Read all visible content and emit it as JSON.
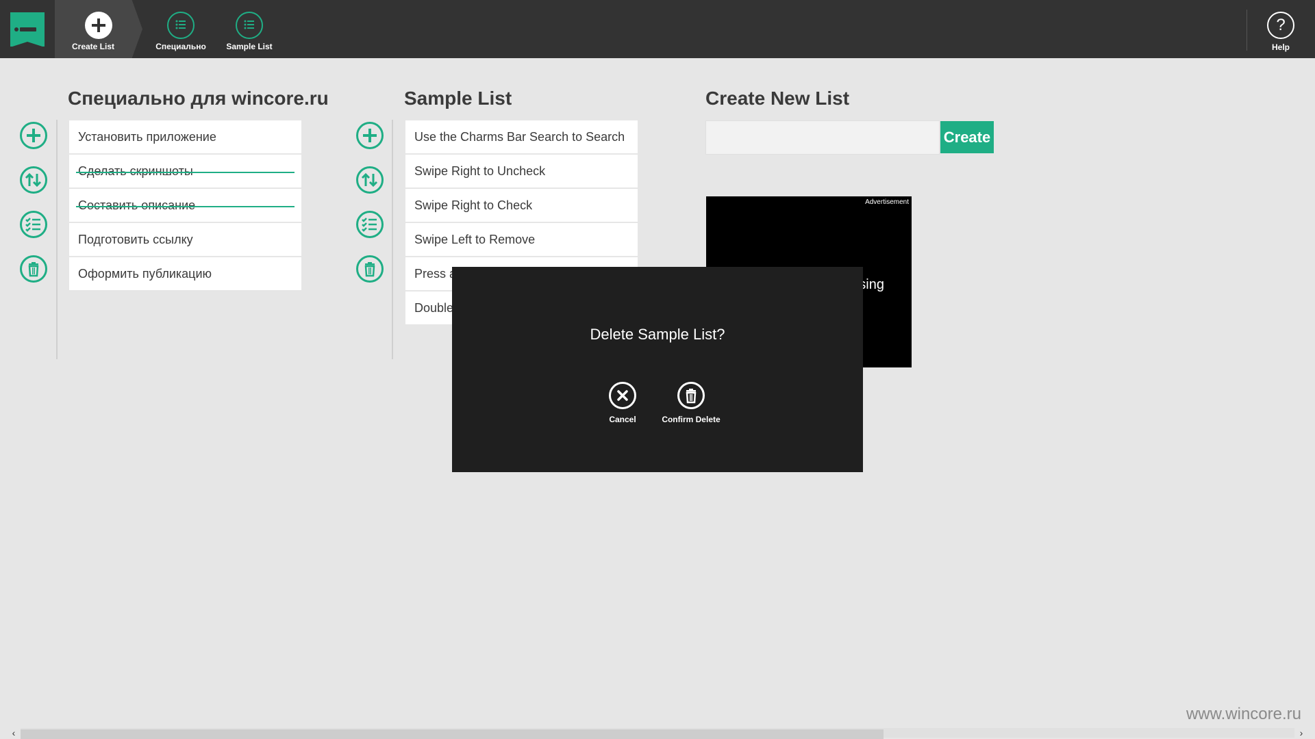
{
  "topbar": {
    "nav": [
      {
        "label": "Create List",
        "icon": "plus-circle-icon"
      },
      {
        "label": "Специально",
        "icon": "list-icon"
      },
      {
        "label": "Sample List",
        "icon": "list-icon"
      }
    ],
    "help": {
      "label": "Help",
      "glyph": "?"
    }
  },
  "list1": {
    "title": "Специально для wincore.ru",
    "items": [
      {
        "text": "Установить приложение",
        "done": false
      },
      {
        "text": "Сделать скриншоты",
        "done": true
      },
      {
        "text": "Составить описание",
        "done": true
      },
      {
        "text": "Подготовить ссылку",
        "done": false
      },
      {
        "text": "Оформить публикацию",
        "done": false
      }
    ]
  },
  "list2": {
    "title": "Sample List",
    "items": [
      {
        "text": "Use the Charms Bar Search to Search",
        "done": false
      },
      {
        "text": "Swipe Right to Uncheck",
        "done": false
      },
      {
        "text": "Swipe Right to Check",
        "done": false
      },
      {
        "text": "Swipe Left to Remove",
        "done": false
      },
      {
        "text": "Press a",
        "done": false
      },
      {
        "text": "Double",
        "done": false
      }
    ]
  },
  "create": {
    "title": "Create New List",
    "input_value": "",
    "button_label": "Create"
  },
  "ad": {
    "label": "Advertisement",
    "text": "sing"
  },
  "dialog": {
    "title": "Delete Sample List?",
    "cancel_label": "Cancel",
    "confirm_label": "Confirm Delete"
  },
  "watermark": "www.wincore.ru",
  "colors": {
    "accent": "#1fae85",
    "topbar": "#333333",
    "background": "#e6e6e6",
    "dialog": "#1f1f1f"
  }
}
